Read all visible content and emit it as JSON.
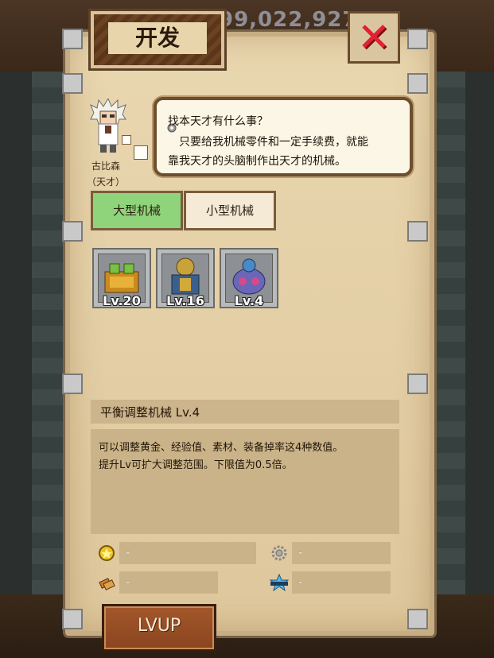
{
  "background": {
    "currency_value": "99,022,927"
  },
  "dialog": {
    "title": "开发",
    "close_label": "✕"
  },
  "npc": {
    "name": "古比森",
    "title": "（天才）",
    "speech_lines": [
      "找本天才有什么事？",
      "只要给我机械零件和一定手续费，就能",
      "靠我天才的头脑制作出天才的机械。"
    ]
  },
  "tabs": [
    {
      "label": "大型机械",
      "active": true
    },
    {
      "label": "小型机械",
      "active": false
    }
  ],
  "items": [
    {
      "level": "Lv.20",
      "icon": "gold-machine-icon"
    },
    {
      "level": "Lv.16",
      "icon": "blue-gear-machine-icon"
    },
    {
      "level": "Lv.4",
      "icon": "balance-machine-icon"
    }
  ],
  "detail": {
    "name": "平衡调整机械 Lv.4",
    "description_lines": [
      "可以调整黄金、经验值、素材、装备掉率这4种数值。",
      "提升Lv可扩大调整范围。下限值为0.5倍。"
    ]
  },
  "costs": [
    {
      "icon": "gold-coin-icon",
      "value": "-"
    },
    {
      "icon": "gear-part-icon",
      "value": "-"
    },
    {
      "icon": "material-icon",
      "value": "-"
    },
    {
      "icon": "rank-icon",
      "value": "-"
    }
  ],
  "lvup_label": "LVUP",
  "colors": {
    "active_tab": "#8fd37a",
    "close_red": "#e32032",
    "parchment": "#e4cfa6"
  }
}
